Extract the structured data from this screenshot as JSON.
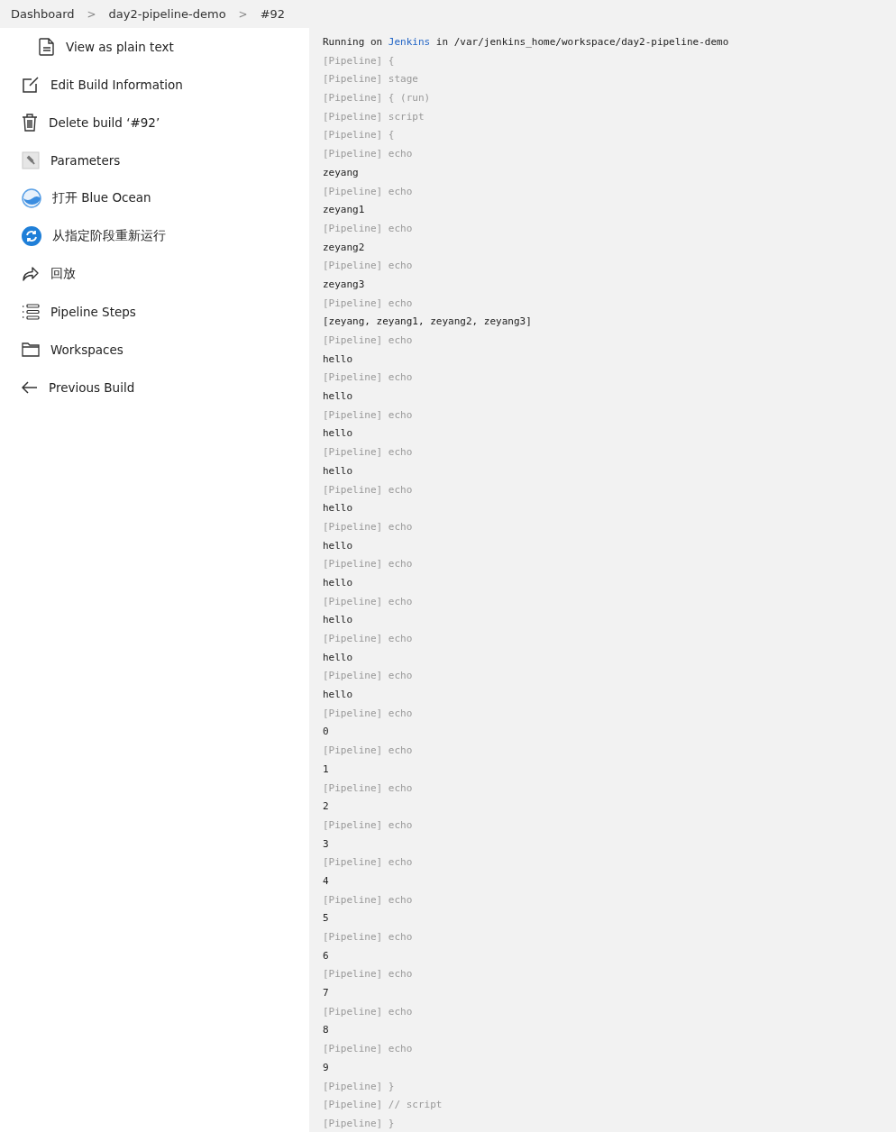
{
  "breadcrumbs": [
    {
      "label": "Dashboard"
    },
    {
      "label": "day2-pipeline-demo"
    },
    {
      "label": "#92"
    }
  ],
  "separator": ">",
  "sidebar": {
    "items": [
      {
        "label": "View as plain text",
        "kind": "subitem"
      },
      {
        "label": "Edit Build Information",
        "kind": "item"
      },
      {
        "label": "Delete build ‘#92’",
        "kind": "item"
      },
      {
        "label": "Parameters",
        "kind": "item"
      },
      {
        "label": "打开 Blue Ocean",
        "kind": "item"
      },
      {
        "label": "从指定阶段重新运行",
        "kind": "item"
      },
      {
        "label": "回放",
        "kind": "item"
      },
      {
        "label": "Pipeline Steps",
        "kind": "item"
      },
      {
        "label": "Workspaces",
        "kind": "item"
      },
      {
        "label": "Previous Build",
        "kind": "item"
      }
    ]
  },
  "console": {
    "header": {
      "prefix": "Running on ",
      "link": "Jenkins",
      "suffix": " in /var/jenkins_home/workspace/day2-pipeline-demo"
    },
    "lines": [
      {
        "text": "[Pipeline] {",
        "kind": "step"
      },
      {
        "text": "[Pipeline] stage",
        "kind": "step"
      },
      {
        "text": "[Pipeline] { (run)",
        "kind": "step"
      },
      {
        "text": "[Pipeline] script",
        "kind": "step"
      },
      {
        "text": "[Pipeline] {",
        "kind": "step"
      },
      {
        "text": "[Pipeline] echo",
        "kind": "step"
      },
      {
        "text": "zeyang",
        "kind": "output"
      },
      {
        "text": "[Pipeline] echo",
        "kind": "step"
      },
      {
        "text": "zeyang1",
        "kind": "output"
      },
      {
        "text": "[Pipeline] echo",
        "kind": "step"
      },
      {
        "text": "zeyang2",
        "kind": "output"
      },
      {
        "text": "[Pipeline] echo",
        "kind": "step"
      },
      {
        "text": "zeyang3",
        "kind": "output"
      },
      {
        "text": "[Pipeline] echo",
        "kind": "step"
      },
      {
        "text": "[zeyang, zeyang1, zeyang2, zeyang3]",
        "kind": "output"
      },
      {
        "text": "[Pipeline] echo",
        "kind": "step"
      },
      {
        "text": "hello",
        "kind": "output"
      },
      {
        "text": "[Pipeline] echo",
        "kind": "step"
      },
      {
        "text": "hello",
        "kind": "output"
      },
      {
        "text": "[Pipeline] echo",
        "kind": "step"
      },
      {
        "text": "hello",
        "kind": "output"
      },
      {
        "text": "[Pipeline] echo",
        "kind": "step"
      },
      {
        "text": "hello",
        "kind": "output"
      },
      {
        "text": "[Pipeline] echo",
        "kind": "step"
      },
      {
        "text": "hello",
        "kind": "output"
      },
      {
        "text": "[Pipeline] echo",
        "kind": "step"
      },
      {
        "text": "hello",
        "kind": "output"
      },
      {
        "text": "[Pipeline] echo",
        "kind": "step"
      },
      {
        "text": "hello",
        "kind": "output"
      },
      {
        "text": "[Pipeline] echo",
        "kind": "step"
      },
      {
        "text": "hello",
        "kind": "output"
      },
      {
        "text": "[Pipeline] echo",
        "kind": "step"
      },
      {
        "text": "hello",
        "kind": "output"
      },
      {
        "text": "[Pipeline] echo",
        "kind": "step"
      },
      {
        "text": "hello",
        "kind": "output"
      },
      {
        "text": "[Pipeline] echo",
        "kind": "step"
      },
      {
        "text": "0",
        "kind": "output"
      },
      {
        "text": "[Pipeline] echo",
        "kind": "step"
      },
      {
        "text": "1",
        "kind": "output"
      },
      {
        "text": "[Pipeline] echo",
        "kind": "step"
      },
      {
        "text": "2",
        "kind": "output"
      },
      {
        "text": "[Pipeline] echo",
        "kind": "step"
      },
      {
        "text": "3",
        "kind": "output"
      },
      {
        "text": "[Pipeline] echo",
        "kind": "step"
      },
      {
        "text": "4",
        "kind": "output"
      },
      {
        "text": "[Pipeline] echo",
        "kind": "step"
      },
      {
        "text": "5",
        "kind": "output"
      },
      {
        "text": "[Pipeline] echo",
        "kind": "step"
      },
      {
        "text": "6",
        "kind": "output"
      },
      {
        "text": "[Pipeline] echo",
        "kind": "step"
      },
      {
        "text": "7",
        "kind": "output"
      },
      {
        "text": "[Pipeline] echo",
        "kind": "step"
      },
      {
        "text": "8",
        "kind": "output"
      },
      {
        "text": "[Pipeline] echo",
        "kind": "step"
      },
      {
        "text": "9",
        "kind": "output"
      },
      {
        "text": "[Pipeline] }",
        "kind": "step"
      },
      {
        "text": "[Pipeline] // script",
        "kind": "step"
      },
      {
        "text": "[Pipeline] }",
        "kind": "step"
      }
    ]
  }
}
